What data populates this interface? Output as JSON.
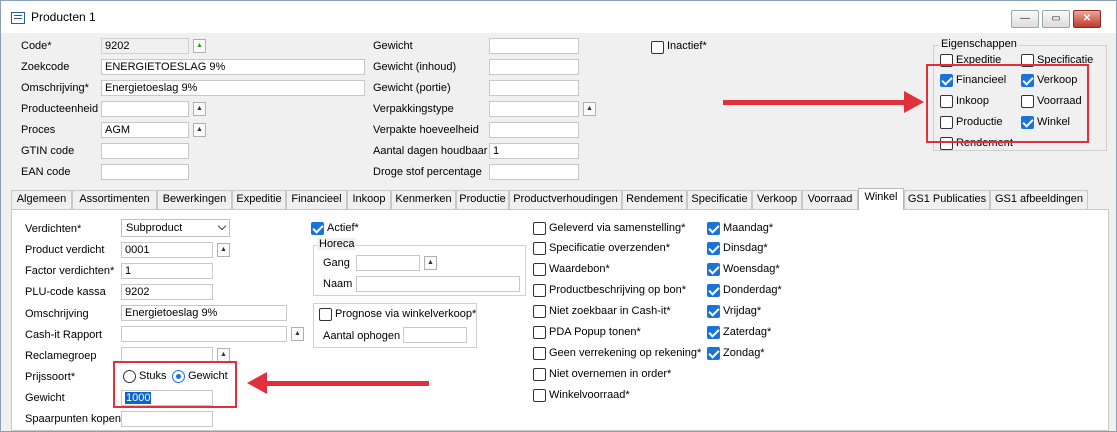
{
  "window": {
    "title": "Producten 1",
    "min": "—",
    "max": "▭",
    "close": "✕"
  },
  "header": {
    "left": [
      {
        "label": "Code*",
        "value": "9202"
      },
      {
        "label": "Zoekcode",
        "value": "ENERGIETOESLAG 9%"
      },
      {
        "label": "Omschrijving*",
        "value": "Energietoeslag 9%"
      },
      {
        "label": "Producteenheid",
        "value": ""
      },
      {
        "label": "Proces",
        "value": "AGM"
      },
      {
        "label": "GTIN code",
        "value": ""
      },
      {
        "label": "EAN code",
        "value": ""
      }
    ],
    "mid": [
      {
        "label": "Gewicht",
        "value": ""
      },
      {
        "label": "Gewicht (inhoud)",
        "value": ""
      },
      {
        "label": "Gewicht (portie)",
        "value": ""
      },
      {
        "label": "Verpakkingstype",
        "value": ""
      },
      {
        "label": "Verpakte hoeveelheid",
        "value": ""
      },
      {
        "label": "Aantal dagen houdbaar",
        "value": "1"
      },
      {
        "label": "Droge stof percentage",
        "value": ""
      }
    ],
    "inactief_label": "Inactief*",
    "inactief_checked": false
  },
  "eigenschappen": {
    "title": "Eigenschappen",
    "items": [
      {
        "label": "Expeditie",
        "checked": false
      },
      {
        "label": "Specificatie",
        "checked": false
      },
      {
        "label": "Financieel",
        "checked": true
      },
      {
        "label": "Verkoop",
        "checked": true
      },
      {
        "label": "Inkoop",
        "checked": false
      },
      {
        "label": "Voorraad",
        "checked": false
      },
      {
        "label": "Productie",
        "checked": false
      },
      {
        "label": "Winkel",
        "checked": true
      },
      {
        "label": "Rendement",
        "checked": false
      }
    ]
  },
  "tabs": [
    "Algemeen",
    "Assortimenten",
    "Bewerkingen",
    "Expeditie",
    "Financieel",
    "Inkoop",
    "Kenmerken",
    "Productie",
    "Productverhoudingen",
    "Rendement",
    "Specificatie",
    "Verkoop",
    "Voorraad",
    "Winkel",
    "GS1 Publicaties",
    "GS1 afbeeldingen"
  ],
  "active_tab": "Winkel",
  "winkel": {
    "verdichten_label": "Verdichten*",
    "verdichten_value": "Subproduct",
    "product_verdicht_label": "Product verdicht",
    "product_verdicht_value": "0001",
    "factor_label": "Factor verdichten*",
    "factor_value": "1",
    "plu_label": "PLU-code kassa",
    "plu_value": "9202",
    "omschrijving_label": "Omschrijving",
    "omschrijving_value": "Energietoeslag 9%",
    "cashit_label": "Cash-it Rapport",
    "cashit_value": "",
    "reclame_label": "Reclamegroep",
    "reclame_value": "",
    "prijssoort_label": "Prijssoort*",
    "stuks_label": "Stuks",
    "gewicht_radio_label": "Gewicht",
    "gewicht_label": "Gewicht",
    "gewicht_value": "1000",
    "spaarpunten_label": "Spaarpunten kopen",
    "spaarpunten_value": "",
    "actief_label": "Actief*",
    "horeca_title": "Horeca",
    "gang_label": "Gang",
    "gang_value": "",
    "naam_label": "Naam",
    "naam_value": "",
    "prognose_label": "Prognose via winkelverkoop*",
    "aantal_label": "Aantal ophogen",
    "aantal_value": "",
    "options": [
      {
        "label": "Geleverd via samenstelling*",
        "checked": false
      },
      {
        "label": "Specificatie overzenden*",
        "checked": false
      },
      {
        "label": "Waardebon*",
        "checked": false
      },
      {
        "label": "Productbeschrijving op bon*",
        "checked": false
      },
      {
        "label": "Niet zoekbaar in Cash-it*",
        "checked": false
      },
      {
        "label": "PDA Popup tonen*",
        "checked": false
      },
      {
        "label": "Geen verrekening op rekening*",
        "checked": false
      },
      {
        "label": "Niet overnemen in order*",
        "checked": false
      },
      {
        "label": "Winkelvoorraad*",
        "checked": false
      }
    ],
    "days": [
      {
        "label": "Maandag*",
        "checked": true
      },
      {
        "label": "Dinsdag*",
        "checked": true
      },
      {
        "label": "Woensdag*",
        "checked": true
      },
      {
        "label": "Donderdag*",
        "checked": true
      },
      {
        "label": "Vrijdag*",
        "checked": true
      },
      {
        "label": "Zaterdag*",
        "checked": true
      },
      {
        "label": "Zondag*",
        "checked": true
      }
    ]
  },
  "colors": {
    "accent": "#1a73d9",
    "highlight": "#e0303c"
  }
}
